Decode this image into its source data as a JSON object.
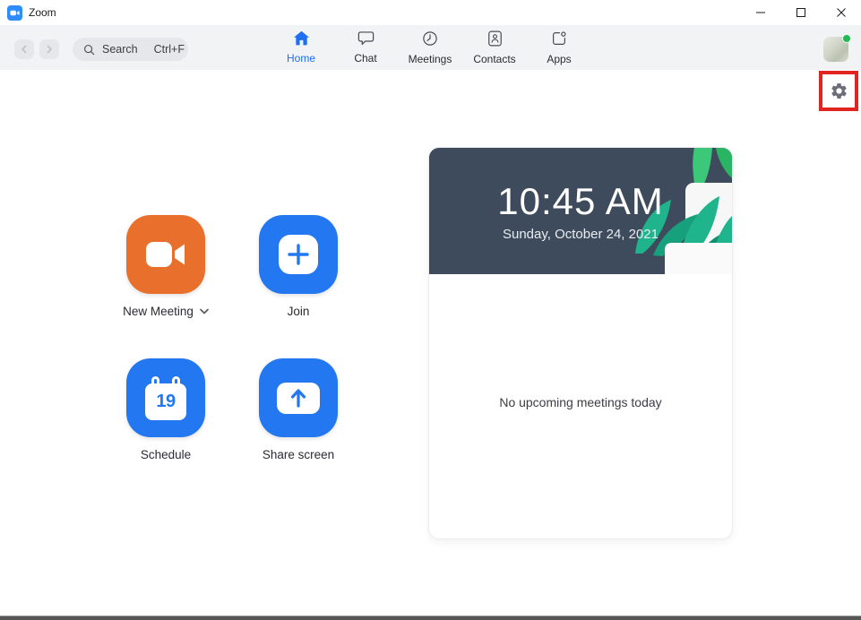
{
  "window": {
    "title": "Zoom",
    "controls": {
      "minimize": "minimize",
      "maximize": "maximize",
      "close": "close"
    }
  },
  "toolbar": {
    "search_placeholder": "Search",
    "search_shortcut": "Ctrl+F",
    "tabs": [
      {
        "label": "Home",
        "active": true
      },
      {
        "label": "Chat",
        "active": false
      },
      {
        "label": "Meetings",
        "active": false
      },
      {
        "label": "Contacts",
        "active": false
      },
      {
        "label": "Apps",
        "active": false
      }
    ],
    "presence_status": "available"
  },
  "annotation": {
    "type": "highlight-rectangle",
    "target": "settings-gear",
    "color": "#e02420"
  },
  "actions": [
    {
      "label": "New Meeting",
      "has_dropdown": true,
      "color": "#e8702c",
      "icon": "video-camera-icon"
    },
    {
      "label": "Join",
      "has_dropdown": false,
      "color": "#2377f1",
      "icon": "plus-icon"
    },
    {
      "label": "Schedule",
      "has_dropdown": false,
      "color": "#2377f1",
      "icon": "calendar-icon",
      "calendar_day": "19"
    },
    {
      "label": "Share screen",
      "has_dropdown": false,
      "color": "#2377f1",
      "icon": "up-arrow-icon"
    }
  ],
  "meetings_panel": {
    "time": "10:45 AM",
    "date": "Sunday, October 24, 2021",
    "empty_message": "No upcoming meetings today"
  },
  "colors": {
    "zoom_blue": "#2377f1",
    "accent_orange": "#e8702c",
    "time_card_bg": "#3d4b5c",
    "toolbar_bg": "#f2f3f5",
    "highlight_red": "#e02420"
  }
}
